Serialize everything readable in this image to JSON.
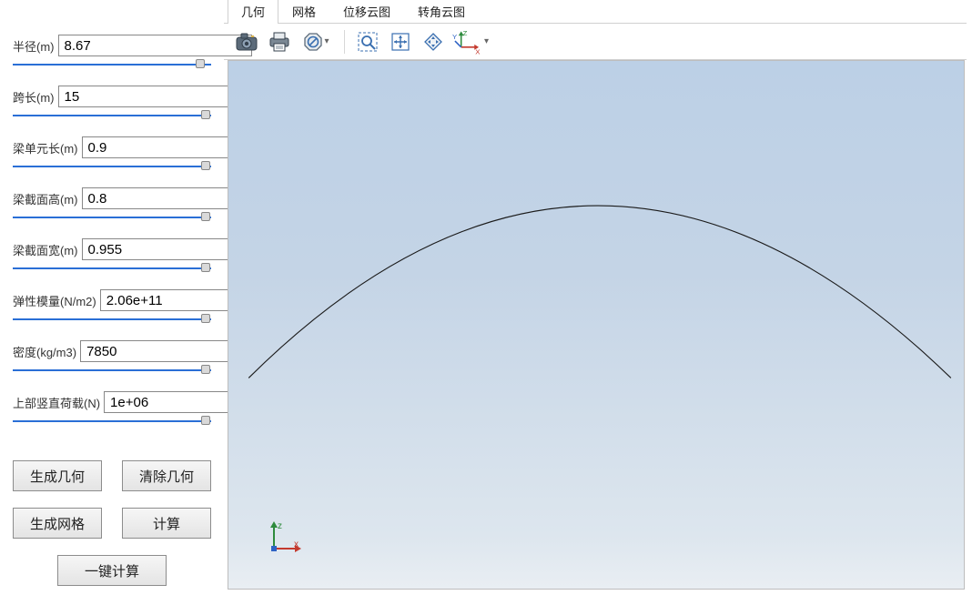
{
  "params": [
    {
      "label": "半径(m)",
      "value": "8.67",
      "thumb_pct": 92
    },
    {
      "label": "跨长(m)",
      "value": "15",
      "thumb_pct": 95
    },
    {
      "label": "梁单元长(m)",
      "value": "0.9",
      "thumb_pct": 95
    },
    {
      "label": "梁截面高(m)",
      "value": "0.8",
      "thumb_pct": 95
    },
    {
      "label": "梁截面宽(m)",
      "value": "0.955",
      "thumb_pct": 95
    },
    {
      "label": "弹性模量(N/m2)",
      "value": "2.06e+11",
      "thumb_pct": 95
    },
    {
      "label": "密度(kg/m3)",
      "value": "7850",
      "thumb_pct": 95
    },
    {
      "label": "上部竖直荷载(N)",
      "value": "1e+06",
      "thumb_pct": 95
    }
  ],
  "buttons": {
    "gen_geom": "生成几何",
    "clear_geom": "清除几何",
    "gen_mesh": "生成网格",
    "calc": "计算",
    "one_click": "一键计算"
  },
  "tabs": [
    {
      "id": "geom",
      "label": "几何",
      "active": true
    },
    {
      "id": "mesh",
      "label": "网格",
      "active": false
    },
    {
      "id": "disp",
      "label": "位移云图",
      "active": false
    },
    {
      "id": "rot",
      "label": "转角云图",
      "active": false
    }
  ],
  "toolbar_icons": {
    "camera": "camera-icon",
    "print": "print-icon",
    "forbid": "forbid-icon",
    "zoom": "zoom-box-icon",
    "fit": "fit-extents-icon",
    "pan": "pan-diamond-icon",
    "axis": "axis-3d-icon"
  },
  "triad_labels": {
    "x": "x",
    "z": "z"
  },
  "axis3d_labels": {
    "x": "X",
    "y": "Y",
    "z": "Z"
  }
}
